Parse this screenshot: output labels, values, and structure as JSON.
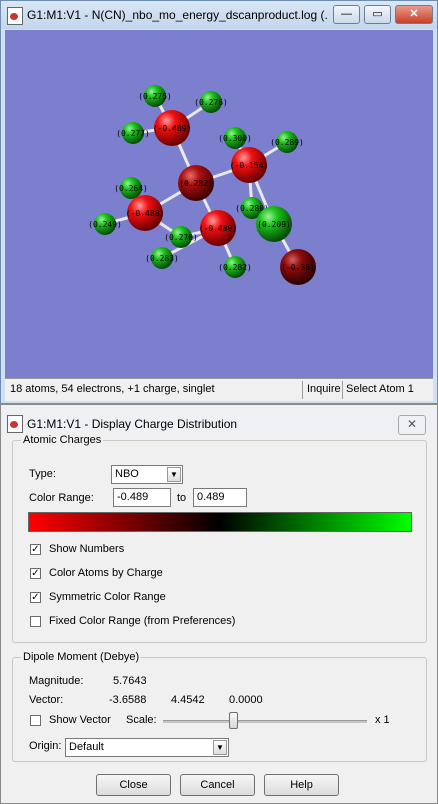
{
  "molecule_window": {
    "title": "G1:M1:V1 - N(CN)_nbo_mo_energy_dscanproduct.log (...",
    "minimize_glyph": "—",
    "maximize_glyph": "▭",
    "close_glyph": "✕",
    "status_info": "18 atoms, 54 electrons, +1 charge, singlet",
    "status_mode": "Inquire",
    "status_action": "Select Atom 1",
    "viewport_bg": "#7b7fcd",
    "atoms": [
      {
        "label": "(0.275)",
        "color": "green"
      },
      {
        "label": "(0.276)",
        "color": "green"
      },
      {
        "label": "(0.277)",
        "color": "green"
      },
      {
        "label": "(-0.489)",
        "color": "red"
      },
      {
        "label": "(0.300)",
        "color": "green"
      },
      {
        "label": "(0.289)",
        "color": "green"
      },
      {
        "label": "(-0.154)",
        "color": "red"
      },
      {
        "label": "(0.282)",
        "color": "darkred"
      },
      {
        "label": "(0.264)",
        "color": "green"
      },
      {
        "label": "(0.280)",
        "color": "green"
      },
      {
        "label": "(-0.488)",
        "color": "red"
      },
      {
        "label": "(0.249)",
        "color": "green"
      },
      {
        "label": "(0.270)",
        "color": "green"
      },
      {
        "label": "(-0.489)",
        "color": "red"
      },
      {
        "label": "(0.209)",
        "color": "green"
      },
      {
        "label": "(0.283)",
        "color": "green"
      },
      {
        "label": "(0.282)",
        "color": "green"
      },
      {
        "label": "(-0.38)",
        "color": "darkred"
      }
    ]
  },
  "charge_dialog": {
    "title": "G1:M1:V1 - Display Charge Distribution",
    "close_glyph": "✕",
    "atomic_charges": {
      "group_label": "Atomic Charges",
      "type_label": "Type:",
      "type_value": "NBO",
      "color_range_label": "Color Range:",
      "range_min": "-0.489",
      "range_to": "to",
      "range_max": "0.489",
      "gradient_colors": [
        "#ff0000",
        "#000000",
        "#00ff00"
      ],
      "checkboxes": [
        {
          "label": "Show Numbers",
          "checked": true
        },
        {
          "label": "Color Atoms by Charge",
          "checked": true
        },
        {
          "label": "Symmetric Color Range",
          "checked": true
        },
        {
          "label": "Fixed Color Range (from Preferences)",
          "checked": false
        }
      ]
    },
    "dipole": {
      "group_label": "Dipole Moment (Debye)",
      "magnitude_label": "Magnitude:",
      "magnitude_value": "5.7643",
      "vector_label": "Vector:",
      "vector_x": "-3.6588",
      "vector_y": "4.4542",
      "vector_z": "0.0000",
      "show_vector_label": "Show Vector",
      "show_vector_checked": false,
      "scale_label": "Scale:",
      "scale_value_label": "x 1",
      "origin_label": "Origin:",
      "origin_value": "Default"
    },
    "buttons": {
      "close": "Close",
      "cancel": "Cancel",
      "help": "Help"
    },
    "check_glyph": "✓",
    "dropdown_glyph": "▼"
  }
}
